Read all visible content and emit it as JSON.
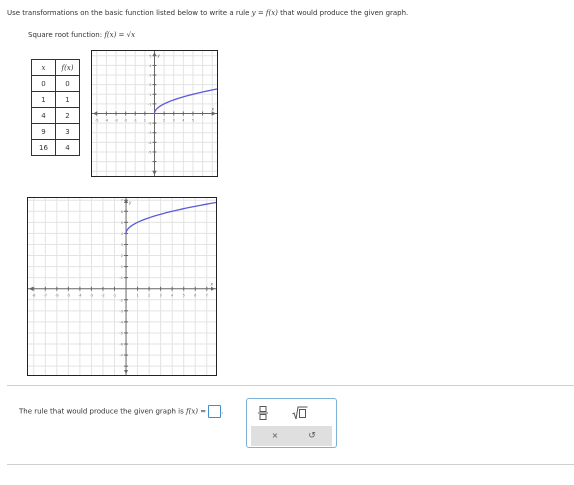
{
  "instructions": {
    "prefix": "Use transformations on the basic function listed below to write a rule ",
    "rule_math": "y = f(x)",
    "suffix": " that would produce the given graph."
  },
  "function_label": {
    "prefix": "Square root function: ",
    "math": "f(x) = √x"
  },
  "table": {
    "headers": [
      "x",
      "f(x)"
    ],
    "rows": [
      [
        "0",
        "0"
      ],
      [
        "1",
        "1"
      ],
      [
        "4",
        "2"
      ],
      [
        "9",
        "3"
      ],
      [
        "16",
        "4"
      ]
    ]
  },
  "graph1": {
    "x_tick_labels": [
      "-5",
      "-4",
      "-3",
      "-2",
      "-1",
      "1",
      "2",
      "3",
      "4",
      "5"
    ],
    "y_tick_labels": [
      "5",
      "4",
      "3",
      "2",
      "1",
      "-1",
      "-2",
      "-3",
      "-4",
      "-5"
    ],
    "axis_x": "x",
    "axis_y": "y",
    "curve_color": "#5b5bdc"
  },
  "graph2": {
    "x_tick_labels": [
      "-8",
      "-7",
      "-6",
      "-5",
      "-4",
      "-3",
      "-2",
      "-1",
      "1",
      "2",
      "3",
      "4",
      "5",
      "6",
      "7"
    ],
    "y_tick_labels": [
      "7",
      "6",
      "5",
      "4",
      "3",
      "2",
      "1",
      "-1",
      "-2",
      "-3",
      "-4",
      "-5",
      "-6",
      "-7"
    ],
    "axis_x": "x",
    "axis_y": "y",
    "curve_color": "#5b5bdc"
  },
  "answer": {
    "prompt": "The rule that would produce the given graph is ",
    "prompt_math": "f(x) =",
    "input_value": "",
    "end": "."
  },
  "palette": {
    "fraction_icon": "fraction-icon",
    "sqrt_icon": "sqrt-icon",
    "clear_label": "×",
    "undo_label": "↺",
    "border_color": "#7fb0d6"
  }
}
